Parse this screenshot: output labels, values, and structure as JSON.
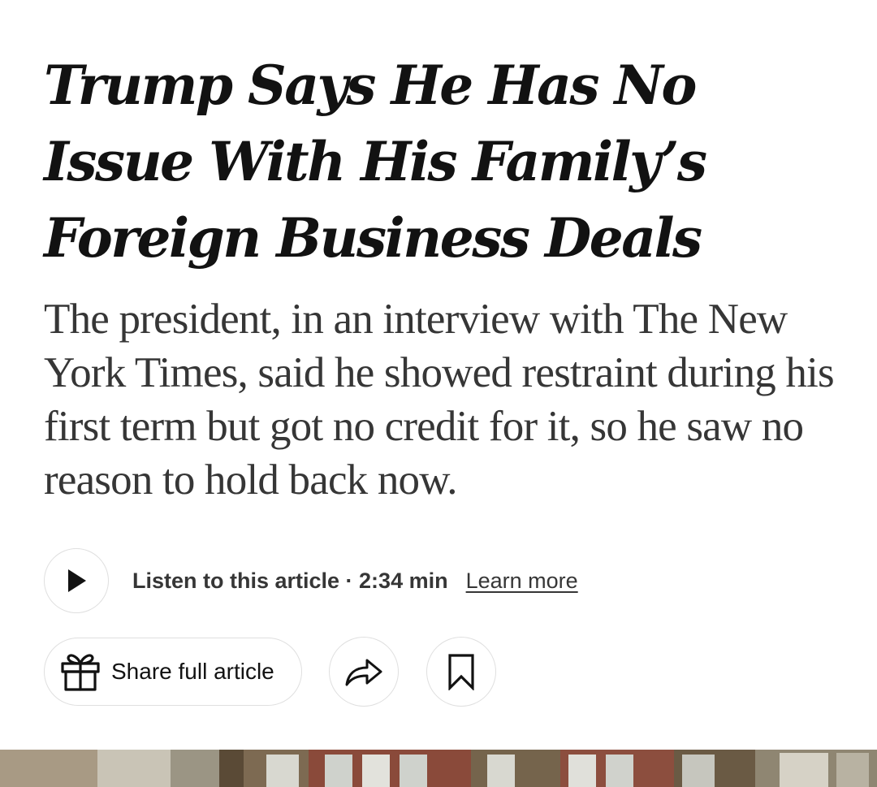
{
  "article": {
    "headline": "Trump Says He Has No Issue With His Family’s Foreign Business Deals",
    "summary": "The president, in an interview with The New York Times, said he showed restraint during his first term but got no credit for it, so he saw no reason to hold back now."
  },
  "audio": {
    "listen_label": "Listen to this article · 2:34 min",
    "learn_more_label": "Learn more",
    "play_icon": "play-icon"
  },
  "actions": {
    "share_full_label": "Share full article",
    "gift_icon": "gift-icon",
    "share_icon": "share-arrow-icon",
    "bookmark_icon": "bookmark-icon"
  },
  "colors": {
    "headline": "#121212",
    "summary": "#363636",
    "border": "#dfdfdf"
  }
}
